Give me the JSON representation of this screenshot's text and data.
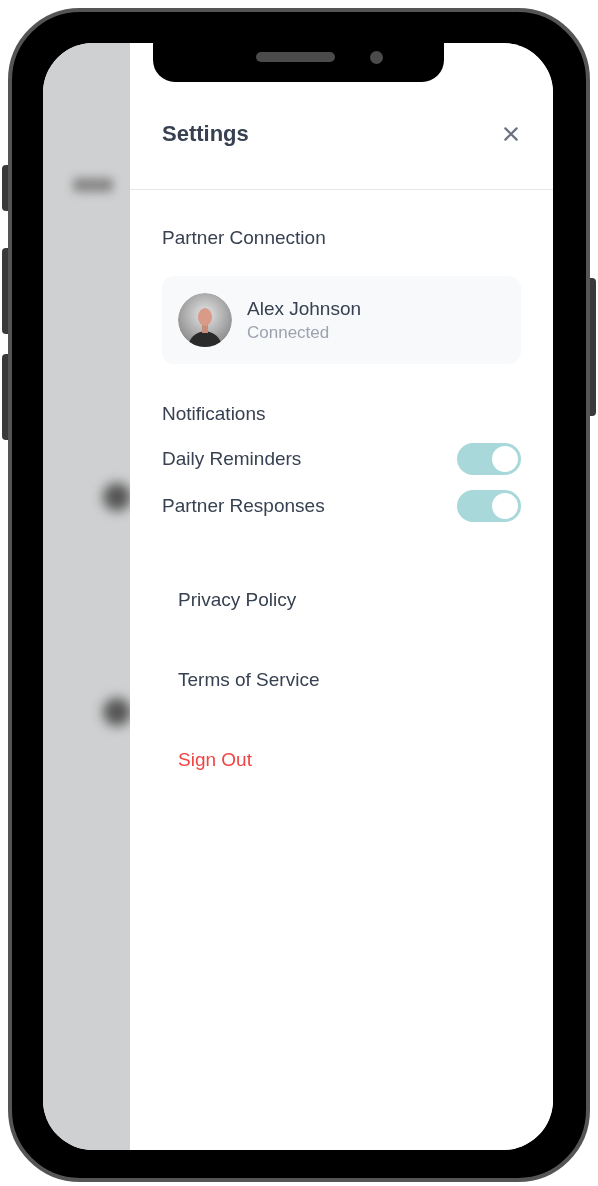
{
  "settings": {
    "title": "Settings"
  },
  "partner_connection": {
    "heading": "Partner Connection",
    "name": "Alex Johnson",
    "status": "Connected"
  },
  "notifications": {
    "heading": "Notifications",
    "toggles": [
      {
        "label": "Daily Reminders",
        "on": true
      },
      {
        "label": "Partner Responses",
        "on": true
      }
    ]
  },
  "links": [
    {
      "label": "Privacy Policy",
      "kind": "normal"
    },
    {
      "label": "Terms of Service",
      "kind": "normal"
    },
    {
      "label": "Sign Out",
      "kind": "danger"
    }
  ]
}
